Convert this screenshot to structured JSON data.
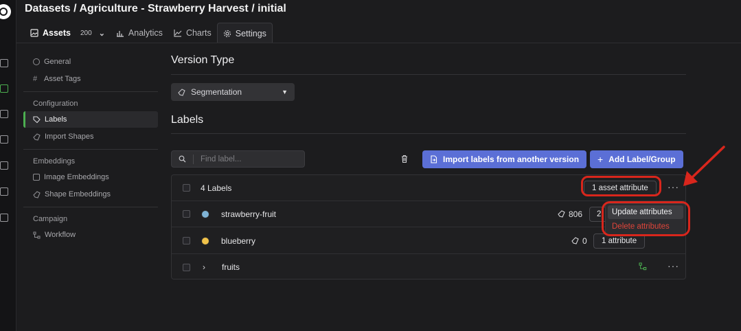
{
  "header": {
    "breadcrumb": "Datasets / Agriculture - Strawberry Harvest / initial"
  },
  "tabs": [
    {
      "label": "Assets",
      "count": "200",
      "icon": "image-icon"
    },
    {
      "label": "Analytics",
      "icon": "bar-chart-icon"
    },
    {
      "label": "Charts",
      "icon": "line-chart-icon"
    },
    {
      "label": "Settings",
      "icon": "gear-icon"
    }
  ],
  "sidebar": {
    "general": "General",
    "asset_tags": "Asset Tags",
    "configuration_heading": "Configuration",
    "labels": "Labels",
    "import_shapes": "Import Shapes",
    "embeddings_heading": "Embeddings",
    "image_embeddings": "Image Embeddings",
    "shape_embeddings": "Shape Embeddings",
    "campaign_heading": "Campaign",
    "workflow": "Workflow"
  },
  "version_type": {
    "title": "Version Type",
    "selected": "Segmentation"
  },
  "labels_section": {
    "title": "Labels",
    "search_placeholder": "Find label...",
    "import_button": "Import labels from another version",
    "add_button": "Add Label/Group",
    "header_label": "4 Labels",
    "asset_attribute_pill": "1 asset attribute",
    "rows": [
      {
        "name": "strawberry-fruit",
        "color": "#7fb3d5",
        "shape_count": "806",
        "attr_pill": "2"
      },
      {
        "name": "blueberry",
        "color": "#f0c24a",
        "shape_count": "0",
        "attr_pill": "1 attribute"
      },
      {
        "name": "fruits",
        "group": true
      }
    ]
  },
  "context_menu": {
    "update": "Update attributes",
    "delete": "Delete attributes"
  },
  "colors": {
    "accent_green": "#4caf50",
    "primary_blue": "#5b6fd6",
    "danger_red": "#e0453a",
    "annotation_red": "#d9261c"
  }
}
